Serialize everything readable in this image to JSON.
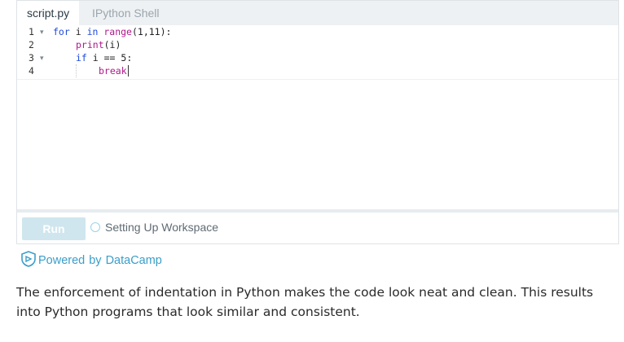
{
  "tabs": {
    "active": "script.py",
    "inactive": "IPython Shell"
  },
  "editor": {
    "line_numbers": [
      "1",
      "2",
      "3",
      "4"
    ],
    "code": {
      "line1": {
        "kw_for": "for",
        "var_i": " i ",
        "kw_in": "in",
        "builtin": " range",
        "rest": "(1,11):"
      },
      "line2": {
        "builtin": "print",
        "rest": "(i)"
      },
      "line3": {
        "kw_if": "if",
        "rest": " i == 5:"
      },
      "line4": {
        "kw_break": "break"
      }
    }
  },
  "runbar": {
    "run_label": "Run",
    "status_text": "Setting Up Workspace"
  },
  "powered_by": {
    "prefix": "Powered",
    "by": "by",
    "brand": "DataCamp"
  },
  "paragraph": "The enforcement of indentation in Python makes the code look neat and clean. This results into Python programs that look similar and consistent.",
  "colors": {
    "keyword": "#1f4bd8",
    "builtin": "#b0188a",
    "link": "#3a9ec9",
    "run_button": "#cfe6ee"
  },
  "icons": {
    "datacamp": "datacamp-shield-icon",
    "fold": "chevron-down-icon",
    "spinner": "loading-spinner-icon"
  }
}
